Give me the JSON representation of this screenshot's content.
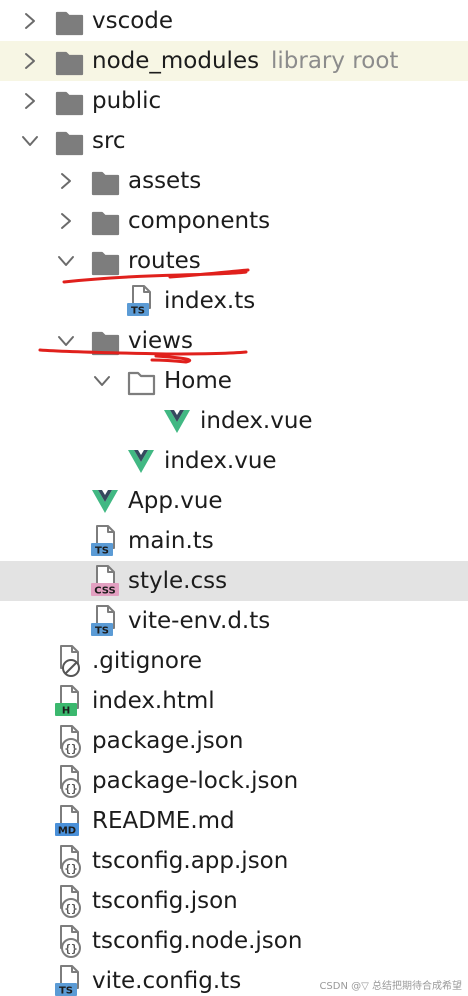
{
  "items": [
    {
      "label": "vscode",
      "sub": "",
      "depth": 0,
      "kind": "folder",
      "chevron": "right",
      "state": ""
    },
    {
      "label": "node_modules",
      "sub": "library root",
      "depth": 0,
      "kind": "folder",
      "chevron": "right",
      "state": "muted"
    },
    {
      "label": "public",
      "sub": "",
      "depth": 0,
      "kind": "folder",
      "chevron": "right",
      "state": ""
    },
    {
      "label": "src",
      "sub": "",
      "depth": 0,
      "kind": "folder",
      "chevron": "down",
      "state": ""
    },
    {
      "label": "assets",
      "sub": "",
      "depth": 1,
      "kind": "folder",
      "chevron": "right",
      "state": ""
    },
    {
      "label": "components",
      "sub": "",
      "depth": 1,
      "kind": "folder",
      "chevron": "right",
      "state": ""
    },
    {
      "label": "routes",
      "sub": "",
      "depth": 1,
      "kind": "folder",
      "chevron": "down",
      "state": ""
    },
    {
      "label": "index.ts",
      "sub": "",
      "depth": 2,
      "kind": "ts",
      "chevron": "",
      "state": ""
    },
    {
      "label": "views",
      "sub": "",
      "depth": 1,
      "kind": "folder",
      "chevron": "down",
      "state": ""
    },
    {
      "label": "Home",
      "sub": "",
      "depth": 2,
      "kind": "folder-open",
      "chevron": "down",
      "state": ""
    },
    {
      "label": "index.vue",
      "sub": "",
      "depth": 3,
      "kind": "vue",
      "chevron": "",
      "state": ""
    },
    {
      "label": "index.vue",
      "sub": "",
      "depth": 2,
      "kind": "vue",
      "chevron": "",
      "state": ""
    },
    {
      "label": "App.vue",
      "sub": "",
      "depth": 1,
      "kind": "vue",
      "chevron": "",
      "state": ""
    },
    {
      "label": "main.ts",
      "sub": "",
      "depth": 1,
      "kind": "ts",
      "chevron": "",
      "state": ""
    },
    {
      "label": "style.css",
      "sub": "",
      "depth": 1,
      "kind": "css",
      "chevron": "",
      "state": "selected"
    },
    {
      "label": "vite-env.d.ts",
      "sub": "",
      "depth": 1,
      "kind": "ts",
      "chevron": "",
      "state": ""
    },
    {
      "label": ".gitignore",
      "sub": "",
      "depth": 0,
      "kind": "gitignore",
      "chevron": "",
      "state": ""
    },
    {
      "label": "index.html",
      "sub": "",
      "depth": 0,
      "kind": "html",
      "chevron": "",
      "state": ""
    },
    {
      "label": "package.json",
      "sub": "",
      "depth": 0,
      "kind": "json",
      "chevron": "",
      "state": ""
    },
    {
      "label": "package-lock.json",
      "sub": "",
      "depth": 0,
      "kind": "json",
      "chevron": "",
      "state": ""
    },
    {
      "label": "README.md",
      "sub": "",
      "depth": 0,
      "kind": "md",
      "chevron": "",
      "state": ""
    },
    {
      "label": "tsconfig.app.json",
      "sub": "",
      "depth": 0,
      "kind": "json",
      "chevron": "",
      "state": ""
    },
    {
      "label": "tsconfig.json",
      "sub": "",
      "depth": 0,
      "kind": "json",
      "chevron": "",
      "state": ""
    },
    {
      "label": "tsconfig.node.json",
      "sub": "",
      "depth": 0,
      "kind": "json",
      "chevron": "",
      "state": ""
    },
    {
      "label": "vite.config.ts",
      "sub": "",
      "depth": 0,
      "kind": "ts",
      "chevron": "",
      "state": ""
    }
  ],
  "badges": {
    "ts": "TS",
    "css": "CSS",
    "html": "H",
    "md": "MD"
  },
  "colors": {
    "folder": "#7d7d7d",
    "vue_dark": "#35495e",
    "vue_green": "#41b883",
    "ts_badge": "#5b9bd5",
    "css_badge": "#e3a0c1",
    "html_badge": "#3bb86e",
    "md_badge": "#4a90d9",
    "annotation": "#e0201c",
    "muted_row": "#f7f6e4",
    "selected_row": "#e3e3e3"
  },
  "watermark": "CSDN @▽ 总结把期待合成希望"
}
